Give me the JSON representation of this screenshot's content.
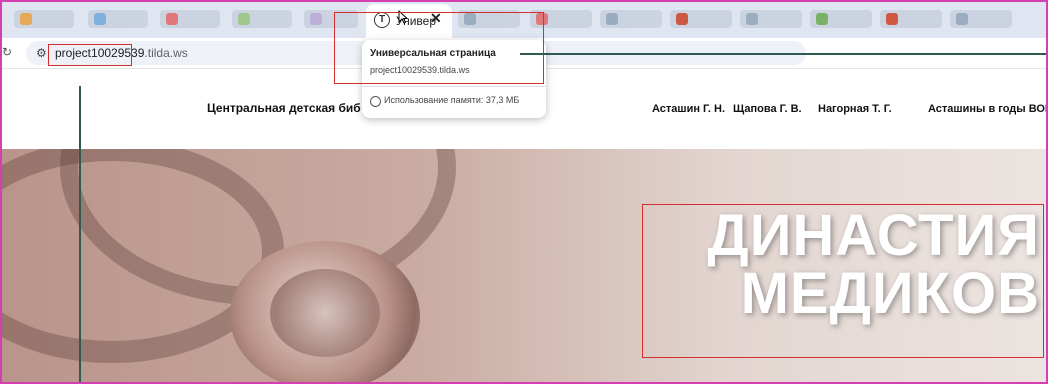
{
  "tabs": {
    "active_title": "Универ",
    "blurred_count": 12
  },
  "address_bar": {
    "url_highlight": "project10029539",
    "url_domain": ".tilda.ws"
  },
  "tab_hover_card": {
    "title": "Универсальная страница",
    "url": "project10029539.tilda.ws",
    "memory_label": "Использование памяти: 37,3 МБ"
  },
  "site": {
    "title": "Центральная детская биб",
    "nav": [
      "Асташин Г. Н.",
      "Щапова Г. В.",
      "Нагорная Т. Г.",
      "Асташины в годы ВОВ"
    ]
  },
  "hero": {
    "line1": "ДИНАСТИЯ",
    "line2": "МЕДИКОВ"
  },
  "colors": {
    "annotation_box": "#d32f2f",
    "annotation_line": "#2f5a52",
    "frame": "#d63fb2"
  }
}
